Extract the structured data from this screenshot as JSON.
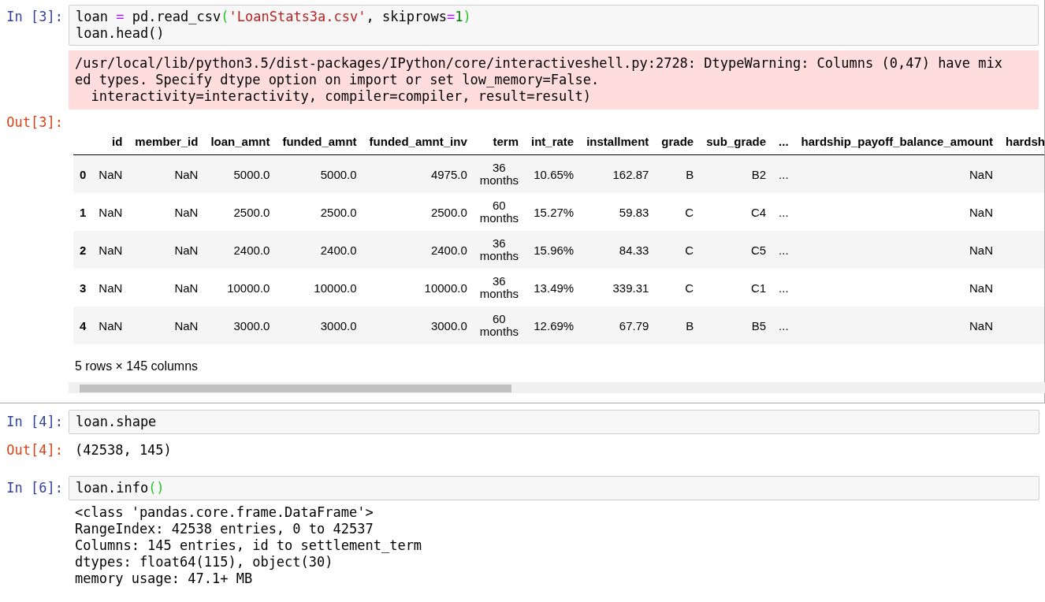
{
  "cells": [
    {
      "prompt": "In [3]:",
      "code": [
        [
          {
            "text": "loan ",
            "kind": "plain"
          },
          {
            "text": "=",
            "kind": "operator"
          },
          {
            "text": " pd.read_csv",
            "kind": "plain"
          },
          {
            "text": "(",
            "kind": "bracket"
          },
          {
            "text": "'LoanStats3a.csv'",
            "kind": "string"
          },
          {
            "text": ", skiprows",
            "kind": "plain"
          },
          {
            "text": "=",
            "kind": "operator"
          },
          {
            "text": "1",
            "kind": "number"
          },
          {
            "text": ")",
            "kind": "bracket"
          }
        ],
        [
          {
            "text": "loan.head()",
            "kind": "plain"
          }
        ]
      ],
      "outputs": [
        {
          "kind": "stderr",
          "lines": [
            "/usr/local/lib/python3.5/dist-packages/IPython/core/interactiveshell.py:2728: DtypeWarning: Columns (0,47) have mix",
            "ed types. Specify dtype option on import or set low_memory=False.",
            "  interactivity=interactivity, compiler=compiler, result=result)"
          ]
        },
        {
          "kind": "dataframe",
          "prompt": "Out[3]:",
          "columns": [
            "id",
            "member_id",
            "loan_amnt",
            "funded_amnt",
            "funded_amnt_inv",
            "term",
            "int_rate",
            "installment",
            "grade",
            "sub_grade",
            "...",
            "hardship_payoff_balance_amount",
            "hardsh"
          ],
          "rows": [
            {
              "index": "0",
              "cells": [
                "NaN",
                "NaN",
                "5000.0",
                "5000.0",
                "4975.0",
                "36 months",
                "10.65%",
                "162.87",
                "B",
                "B2",
                "...",
                "NaN"
              ]
            },
            {
              "index": "1",
              "cells": [
                "NaN",
                "NaN",
                "2500.0",
                "2500.0",
                "2500.0",
                "60 months",
                "15.27%",
                "59.83",
                "C",
                "C4",
                "...",
                "NaN"
              ]
            },
            {
              "index": "2",
              "cells": [
                "NaN",
                "NaN",
                "2400.0",
                "2400.0",
                "2400.0",
                "36 months",
                "15.96%",
                "84.33",
                "C",
                "C5",
                "...",
                "NaN"
              ]
            },
            {
              "index": "3",
              "cells": [
                "NaN",
                "NaN",
                "10000.0",
                "10000.0",
                "10000.0",
                "36 months",
                "13.49%",
                "339.31",
                "C",
                "C1",
                "...",
                "NaN"
              ]
            },
            {
              "index": "4",
              "cells": [
                "NaN",
                "NaN",
                "3000.0",
                "3000.0",
                "3000.0",
                "60 months",
                "12.69%",
                "67.79",
                "B",
                "B5",
                "...",
                "NaN"
              ]
            }
          ],
          "summary": "5 rows × 145 columns"
        }
      ]
    },
    {
      "prompt": "In [4]:",
      "code": [
        [
          {
            "text": "loan.shape",
            "kind": "plain"
          }
        ]
      ],
      "outputs": [
        {
          "kind": "result",
          "prompt": "Out[4]:",
          "lines": [
            "(42538, 145)"
          ]
        }
      ]
    },
    {
      "prompt": "In [6]:",
      "code": [
        [
          {
            "text": "loan.info",
            "kind": "plain"
          },
          {
            "text": "()",
            "kind": "bracket"
          }
        ]
      ],
      "outputs": [
        {
          "kind": "stdout",
          "lines": [
            "<class 'pandas.core.frame.DataFrame'>",
            "RangeIndex: 42538 entries, 0 to 42537",
            "Columns: 145 entries, id to settlement_term",
            "dtypes: float64(115), object(30)",
            "memory usage: 47.1+ MB"
          ]
        }
      ]
    }
  ]
}
